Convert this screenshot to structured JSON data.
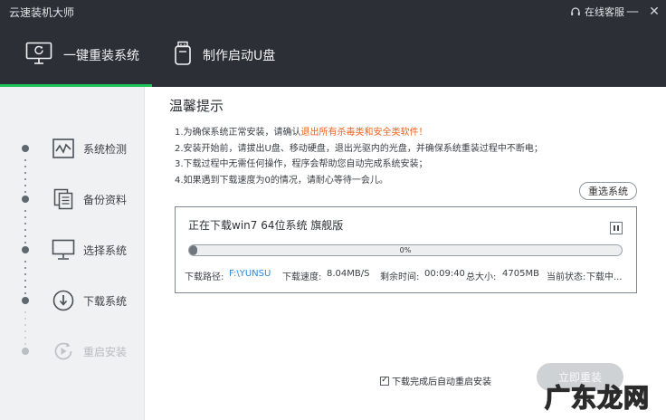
{
  "window": {
    "title": "云速装机大师",
    "service_label": "在线客服",
    "minimize": "—",
    "close": "✕"
  },
  "nav": {
    "tabs": [
      {
        "label": "一键重装系统",
        "active": true,
        "icon": "monitor-reinstall-icon"
      },
      {
        "label": "制作启动U盘",
        "active": false,
        "icon": "usb-drive-icon"
      }
    ]
  },
  "sidebar": {
    "steps": [
      {
        "label": "系统检测",
        "icon": "pulse-chart-icon",
        "state": "done"
      },
      {
        "label": "备份资料",
        "icon": "documents-icon",
        "state": "done"
      },
      {
        "label": "选择系统",
        "icon": "monitor-icon",
        "state": "done"
      },
      {
        "label": "下载系统",
        "icon": "download-icon",
        "state": "current"
      },
      {
        "label": "重启安装",
        "icon": "restart-icon",
        "state": "pending"
      }
    ]
  },
  "notice": {
    "title": "温馨提示",
    "line1_prefix": "1.为确保系统正常安装，请确认",
    "line1_warn": "退出所有杀毒类和安全类软件！",
    "line2": "2.安装开始前，请拔出U盘、移动硬盘，退出光驱内的光盘，并确保系统重装过程中不断电；",
    "line3": "3.下载过程中无需任何操作，程序会帮助您自动完成系统安装；",
    "line4": "4.如果遇到下载速度为0的情况，请耐心等待一会儿。"
  },
  "reselect_button": "重选系统",
  "download": {
    "title": "正在下载win7 64位系统 旗舰版",
    "progress_label": "0%",
    "progress_value": 0,
    "path_label": "下载路径:",
    "path_value": "F:\\YUNSU",
    "speed_label": "下载速度:",
    "speed_value": "8.04MB/S",
    "remaining_label": "剩余时间:",
    "remaining_value": "00:09:40",
    "size_label": "总大小:",
    "size_value": "4705MB",
    "status_label": "当前状态:",
    "status_value": "下载中..."
  },
  "auto_restart": {
    "label": "下载完成后自动重启安装",
    "checked": true,
    "check_glyph": "✓"
  },
  "install_button": "立即重装",
  "watermark": "广东龙网",
  "colors": {
    "header_bg": "#2c3036",
    "accent_green": "#20c35a",
    "warning_orange": "#f0621e",
    "path_blue": "#2a88d8"
  }
}
